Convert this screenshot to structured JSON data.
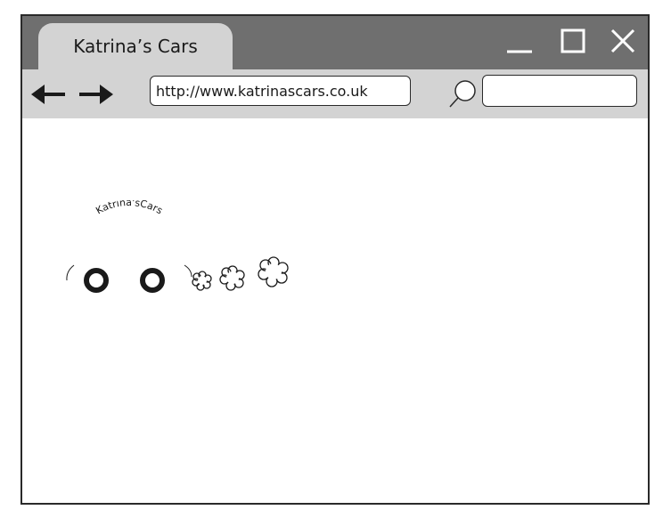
{
  "window": {
    "tab_title": "Katrina’s Cars",
    "controls": {
      "minimize": "minimize-icon",
      "maximize": "maximize-icon",
      "close": "close-icon"
    }
  },
  "toolbar": {
    "back_icon": "arrow-left-icon",
    "forward_icon": "arrow-right-icon",
    "address_value": "http://www.katrinascars.co.uk",
    "search_icon": "magnifier-icon",
    "search_value": ""
  },
  "page": {
    "logo_text": "Katrina'sCars",
    "logo_icons": [
      "car-icon",
      "exhaust-cloud-icon"
    ]
  },
  "colors": {
    "titlebar": "#6f6f6f",
    "toolbar": "#d3d3d3",
    "outline": "#2a2a2a",
    "background": "#ffffff"
  }
}
